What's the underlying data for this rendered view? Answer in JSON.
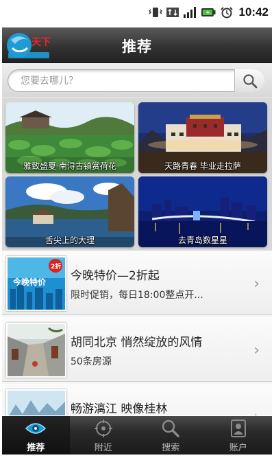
{
  "status_bar": {
    "time": "10:42"
  },
  "header": {
    "title": "推荐",
    "logo_text": "天下"
  },
  "search": {
    "placeholder": "您要去哪儿？"
  },
  "tiles": [
    {
      "caption": "雅致盛夏 南浔古镇赏荷花"
    },
    {
      "caption": "天路青春 毕业走拉萨"
    },
    {
      "caption": "舌尖上的大理"
    },
    {
      "caption": "去青岛数星星"
    }
  ],
  "list": [
    {
      "title": "今晚特价—2折起",
      "subtitle": "限时促销，每日18:00整点开...",
      "thumb_badge": "2折",
      "thumb_text": "今晚特价"
    },
    {
      "title": "胡同北京 悄然绽放的风情",
      "subtitle": "50条房源"
    },
    {
      "title": "畅游漓江 映像桂林",
      "subtitle": ""
    }
  ],
  "tabs": [
    {
      "label": "推荐",
      "icon": "eye-icon",
      "active": true
    },
    {
      "label": "附近",
      "icon": "location-target-icon",
      "active": false
    },
    {
      "label": "搜索",
      "icon": "search-icon",
      "active": false
    },
    {
      "label": "账户",
      "icon": "account-icon",
      "active": false
    }
  ],
  "colors": {
    "header_bg": "#333333",
    "tabbar_bg": "#1b1b1b",
    "logo_blue": "#1f9ad6",
    "badge_red": "#e02020"
  }
}
